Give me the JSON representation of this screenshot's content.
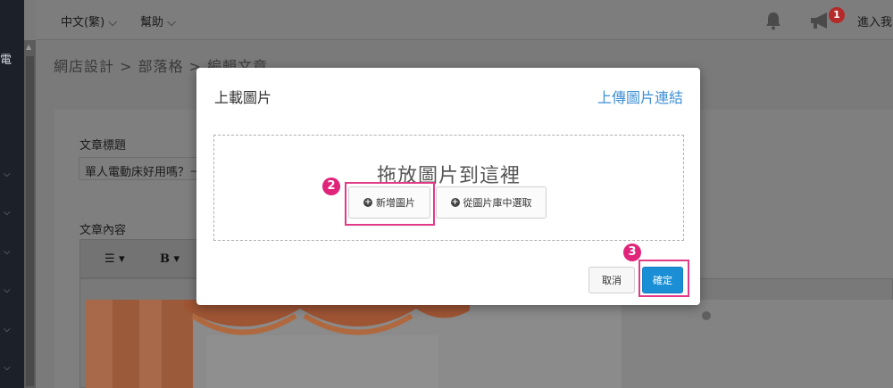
{
  "sidebar": {
    "text": "電"
  },
  "topbar": {
    "language": "中文(繁) ⌵",
    "help": "幫助 ⌵",
    "notification_count": "1",
    "user_text": "進入我"
  },
  "breadcrumb": "網店設計 > 部落格 > 編輯文章",
  "form": {
    "title_label": "文章標題",
    "title_value": "單人電動床好用嗎？－",
    "content_label": "文章內容",
    "toolbar_list": "☰ ▾",
    "toolbar_bold": "B ▾"
  },
  "modal": {
    "title": "上載圖片",
    "link": "上傳圖片連結",
    "drop_text": "拖放圖片到這裡",
    "add_button": "新增圖片",
    "library_button": "從圖片庫中選取",
    "cancel_button": "取消",
    "ok_button": "確定",
    "step_add": "2",
    "step_ok": "3"
  },
  "colors": {
    "link": "#3d8fd6",
    "primary_button": "#1a8fd6",
    "highlight": "#e13a86",
    "step_badge": "#e0247a",
    "notification_badge": "#b52a2a"
  }
}
